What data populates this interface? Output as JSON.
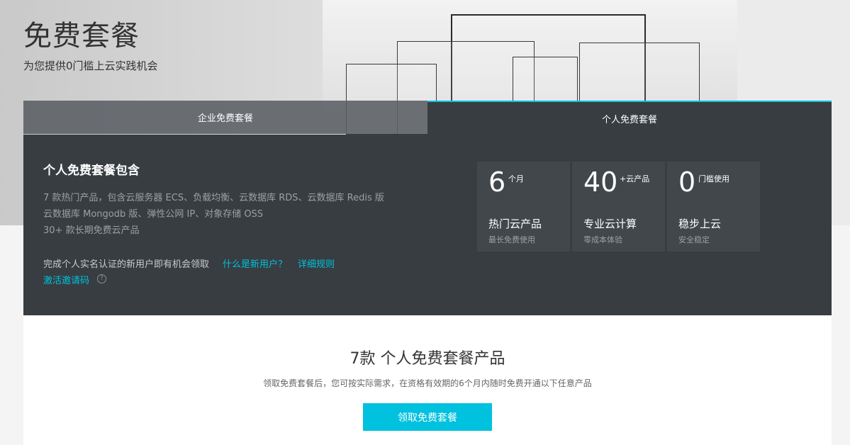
{
  "hero": {
    "title": "免费套餐",
    "subtitle": "为您提供0门槛上云实践机会"
  },
  "tabs": [
    {
      "label": "企业免费套餐",
      "active": false
    },
    {
      "label": "个人免费套餐",
      "active": true
    }
  ],
  "panel": {
    "title": "个人免费套餐包含",
    "features": [
      "7  款热门产品，包含云服务器 ECS、负载均衡、云数据库 RDS、云数据库 Redis 版",
      "云数据库 Mongodb 版、弹性公网 IP、对象存储 OSS",
      "30+ 款长期免费云产品"
    ],
    "notice": "完成个人实名认证的新用户即有机会领取",
    "link_what_is_new_user": "什么是新用户？",
    "link_rules": "详细规则",
    "link_invite_code": "激活邀请码",
    "help_icon_glyph": "?"
  },
  "stats": [
    {
      "number": "6",
      "unit": "个月",
      "label": "热门云产品",
      "sub": "最长免费使用"
    },
    {
      "number": "40",
      "unit": "+云产品",
      "label": "专业云计算",
      "sub": "零成本体验"
    },
    {
      "number": "0",
      "unit": "门槛使用",
      "label": "稳步上云",
      "sub": "安全稳定"
    }
  ],
  "card": {
    "title": "7款 个人免费套餐产品",
    "description": "领取免费套餐后，您可按实际需求，在资格有效期的6个月内随时免费开通以下任意产品",
    "cta_label": "领取免费套餐"
  },
  "colors": {
    "accent": "#00c1de",
    "panel_bg": "#373d41",
    "stat_bg": "#41474b"
  }
}
